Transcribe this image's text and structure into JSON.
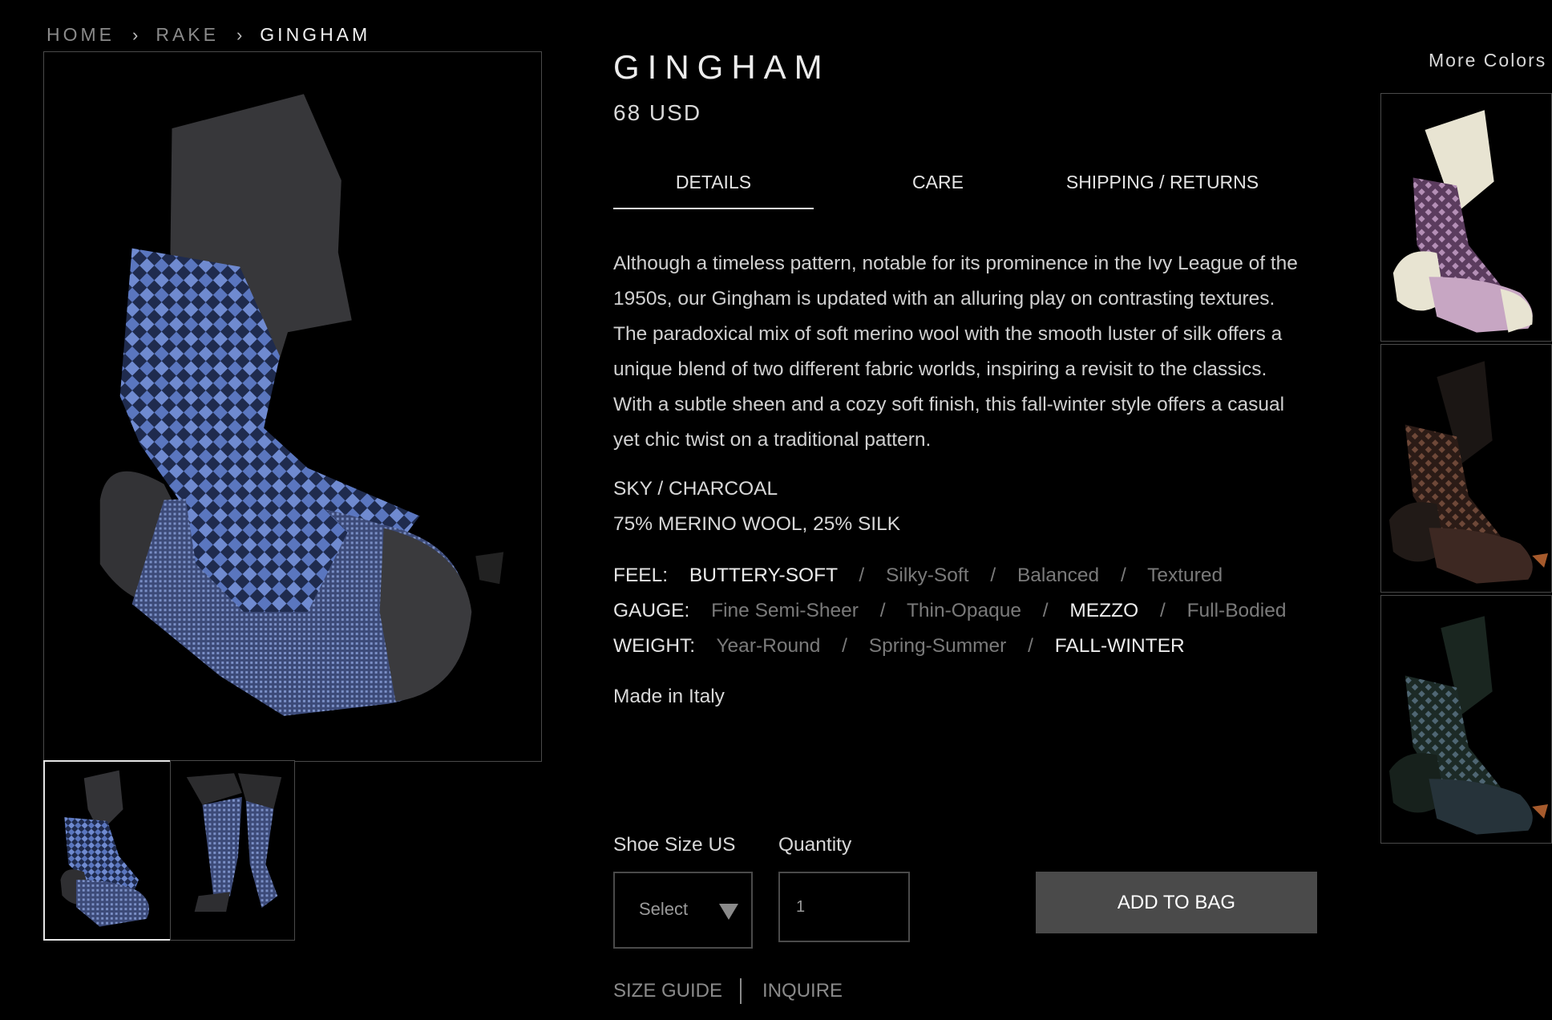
{
  "breadcrumb": {
    "items": [
      "HOME",
      "RAKE",
      "GINGHAM"
    ],
    "separator": "›"
  },
  "product": {
    "title": "GINGHAM",
    "price": "68 USD",
    "colors": {
      "primary": "#4a63a8",
      "secondary": "#3a3a3c"
    }
  },
  "tabs": {
    "details": "DETAILS",
    "care": "CARE",
    "shipping": "SHIPPING / RETURNS",
    "active": "DETAILS"
  },
  "description": "Although a timeless pattern, notable for its prominence in the Ivy League of the 1950s, our Gingham is updated with an alluring play on contrasting textures.  The paradoxical mix of soft merino wool with the smooth luster of silk offers a unique blend of two different fabric worlds, inspiring a revisit to the classics.  With a subtle sheen and a cozy soft finish, this fall-winter style offers a casual yet chic twist on a traditional pattern.",
  "specs": {
    "color": "SKY / CHARCOAL",
    "composition": "75% MERINO WOOL, 25% SILK"
  },
  "attributes": {
    "feel": {
      "label": "FEEL:",
      "options": [
        "BUTTERY-SOFT",
        "Silky-Soft",
        "Balanced",
        "Textured"
      ],
      "selected": "BUTTERY-SOFT"
    },
    "gauge": {
      "label": "GAUGE:",
      "options": [
        "Fine Semi-Sheer",
        "Thin-Opaque",
        "MEZZO",
        "Full-Bodied"
      ],
      "selected": "MEZZO"
    },
    "weight": {
      "label": "WEIGHT:",
      "options": [
        "Year-Round",
        "Spring-Summer",
        "FALL-WINTER"
      ],
      "selected": "FALL-WINTER"
    },
    "separator": "/"
  },
  "made_in": "Made in Italy",
  "purchase": {
    "size_label": "Shoe Size US",
    "size_value": "Select",
    "quantity_label": "Quantity",
    "quantity_value": "1",
    "add_to_bag": "ADD TO BAG"
  },
  "links": {
    "size_guide": "SIZE GUIDE",
    "inquire": "INQUIRE"
  },
  "more_colors": {
    "label": "More Colors",
    "swatches": [
      {
        "name": "lilac-ivory",
        "pattern": "#a77fa8",
        "solid": "#e8e4d2"
      },
      {
        "name": "brown-black",
        "pattern": "#5e3d30",
        "solid": "#1b1614"
      },
      {
        "name": "grey-green",
        "pattern": "#4d5d68",
        "solid": "#1a2620"
      }
    ]
  },
  "thumbnails": [
    {
      "icon": "sock-flat-icon"
    },
    {
      "icon": "sock-worn-icon"
    }
  ]
}
